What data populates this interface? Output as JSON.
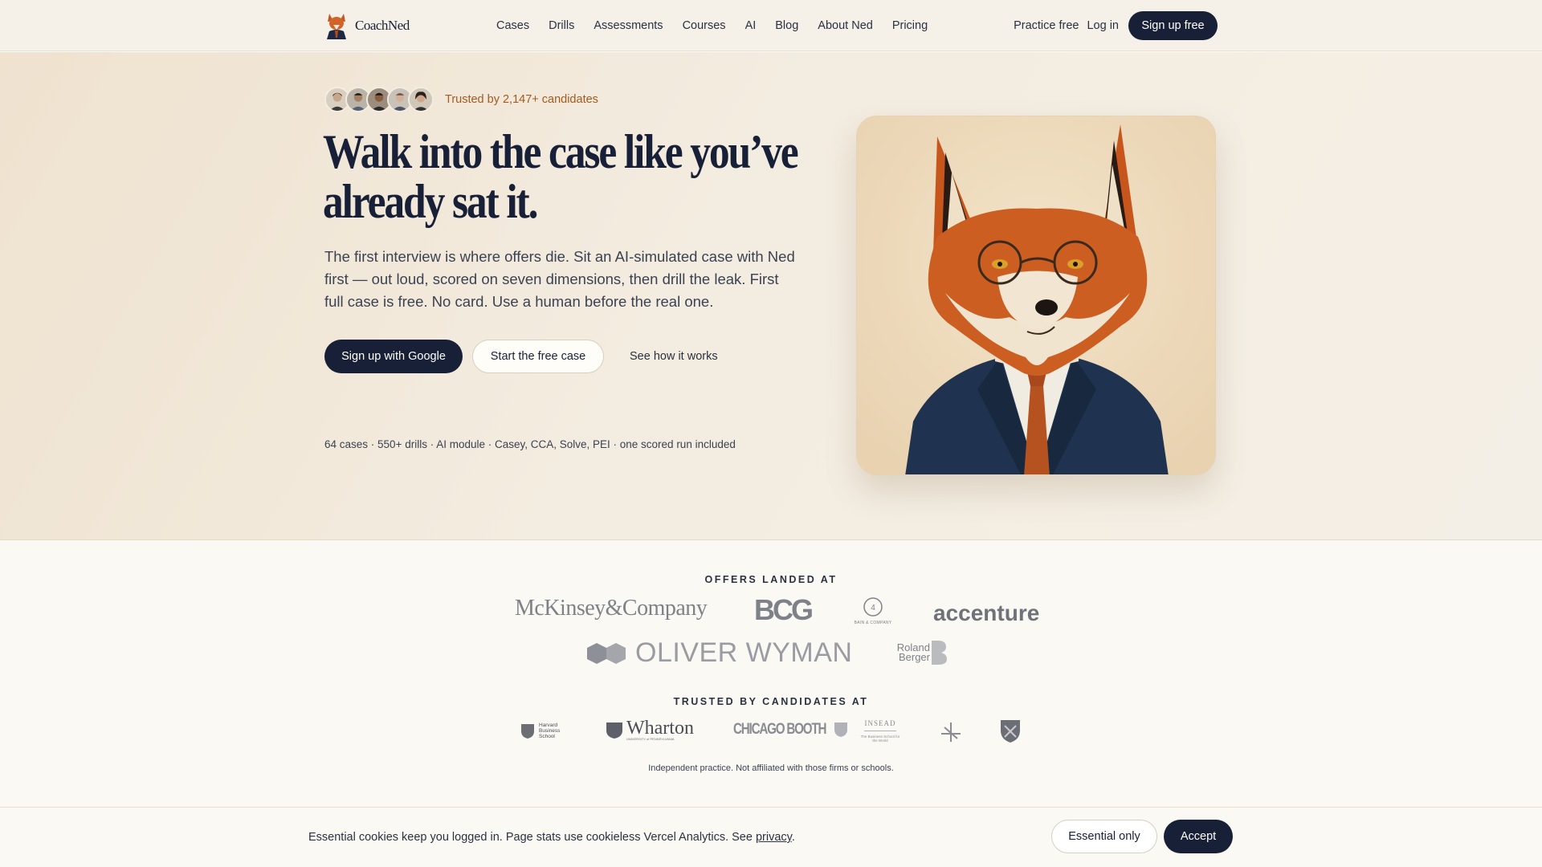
{
  "nav": {
    "brand": "CoachNed",
    "links": [
      "Cases",
      "Drills",
      "Assessments",
      "Courses",
      "AI",
      "Blog",
      "About Ned",
      "Pricing"
    ],
    "practice": "Practice free",
    "login": "Log in",
    "signup": "Sign up free"
  },
  "hero": {
    "trusted": "Trusted by 2,147+ candidates",
    "title_line1": "Walk into the case like you’ve",
    "title_line2": "already sat it.",
    "lead": "The first interview is where offers die. Sit an AI-simulated case with Ned first — out loud, scored on seven dimensions, then drill the leak. First full case is free. No card. Use a human before the real one.",
    "cta_google": "Sign up with Google",
    "cta_free": "Start the free case",
    "cta_how": "See how it works",
    "stats": "64 cases · 550+ drills · AI module · Casey, CCA, Solve, PEI · one scored run included"
  },
  "offers": {
    "label": "OFFERS LANDED AT",
    "firms": [
      "McKinsey&Company",
      "BCG",
      "BAIN & COMPANY",
      "accenture",
      "OLIVER WYMAN",
      "Roland Berger"
    ]
  },
  "schools": {
    "label": "TRUSTED BY CANDIDATES AT",
    "wharton": "Wharton",
    "wharton_sub": "UNIVERSITY of PENNSYLVANIA",
    "hbs": "Harvard Business School",
    "booth": "CHICAGO BOOTH",
    "insead": "INSEAD",
    "insead_sub": "The Business School for the World"
  },
  "disclaimer": "Independent practice. Not affiliated with those firms or schools.",
  "cookie": {
    "text": "Essential cookies keep you logged in. Page stats use cookieless Vercel Analytics. See ",
    "link": "privacy",
    "end": ".",
    "essential": "Essential only",
    "accept": "Accept"
  },
  "colors": {
    "navy": "#182038",
    "accent": "#a15a20",
    "fox": "#c4561e"
  }
}
